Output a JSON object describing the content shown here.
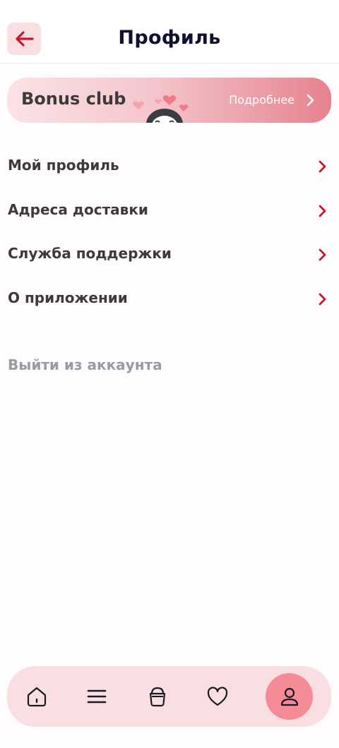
{
  "header": {
    "title": "Профиль",
    "back_icon": "arrow-left-icon"
  },
  "bonus": {
    "title": "Bonus club",
    "more_label": "Подробнее",
    "mascot": "penguin-with-hearts"
  },
  "menu": {
    "items": [
      {
        "label": "Мой профиль"
      },
      {
        "label": "Адреса доставки"
      },
      {
        "label": "Служба поддержки"
      },
      {
        "label": "О приложении"
      }
    ]
  },
  "logout_label": "Выйти из аккаунта",
  "tabbar": {
    "tabs": [
      {
        "icon": "home-icon"
      },
      {
        "icon": "menu-icon"
      },
      {
        "icon": "bag-icon"
      },
      {
        "icon": "heart-icon"
      },
      {
        "icon": "profile-icon",
        "active": true
      }
    ]
  },
  "colors": {
    "accent": "#c6172b",
    "accent_light": "#fadfe2",
    "active_tab": "#f58b97",
    "text": "#3e3a3b",
    "muted": "#9a9aa6"
  }
}
